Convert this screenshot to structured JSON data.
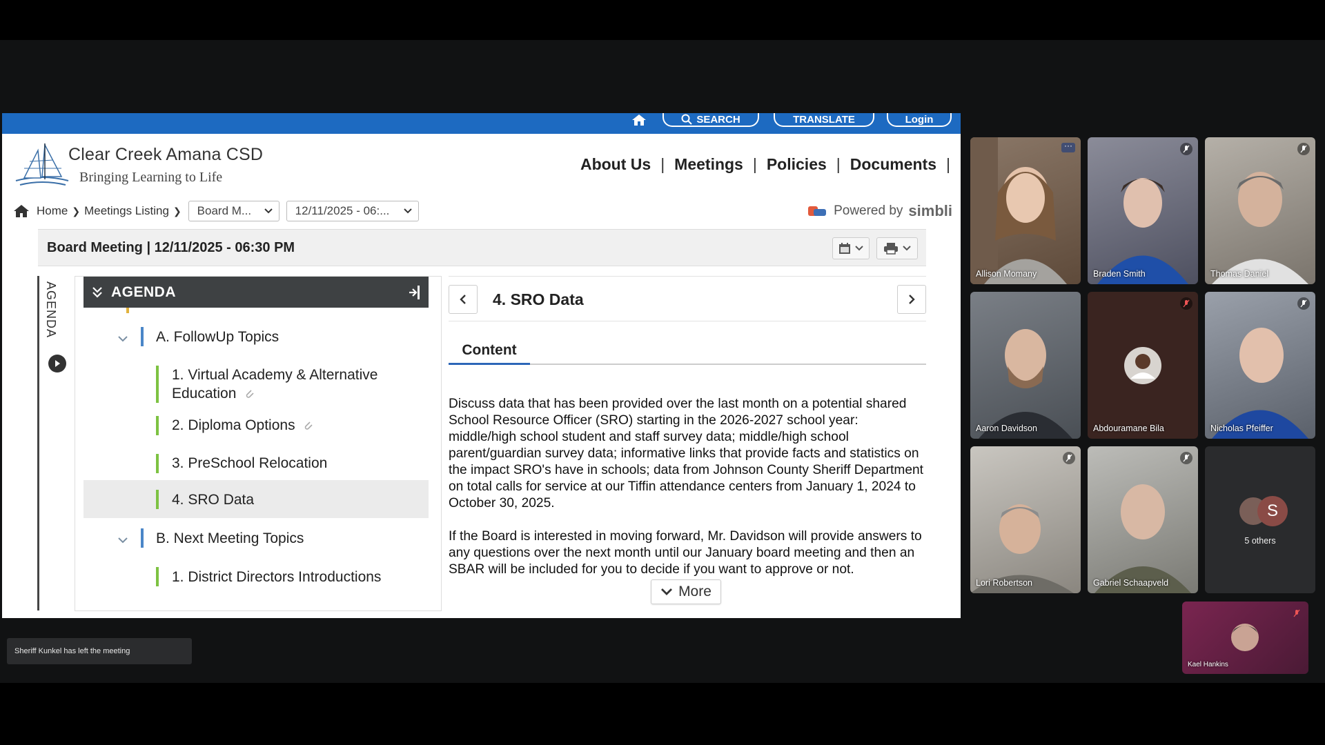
{
  "site": {
    "name": "Clear Creek Amana CSD",
    "tagline": "Bringing Learning to Life",
    "util": {
      "search": "SEARCH",
      "translate": "TRANSLATE",
      "login": "Login"
    },
    "nav": [
      "About Us",
      "Meetings",
      "Policies",
      "Documents"
    ],
    "breadcrumb": {
      "home": "Home",
      "listing": "Meetings Listing",
      "board_select": "Board M...",
      "date_select": "12/11/2025 - 06:..."
    },
    "powered_by": {
      "label": "Powered by",
      "brand": "simbli"
    }
  },
  "meeting": {
    "title": "Board Meeting | 12/11/2025 - 06:30 PM",
    "agenda_rail_label": "AGENDA",
    "agenda_header": "AGENDA",
    "agenda_items": [
      {
        "label": "A. FollowUp Topics",
        "level": "section"
      },
      {
        "label_line1": "1. Virtual Academy & Alternative",
        "label_line2": "Education",
        "level": "item",
        "attachment": true
      },
      {
        "label": "2. Diploma Options",
        "level": "item",
        "attachment": true
      },
      {
        "label": "3. PreSchool Relocation",
        "level": "item"
      },
      {
        "label": "4. SRO Data",
        "level": "item",
        "active": true
      },
      {
        "label": "B. Next Meeting Topics",
        "level": "section"
      },
      {
        "label": "1. District Directors Introductions",
        "level": "item"
      }
    ],
    "current_item": {
      "title": "4. SRO Data",
      "tab": "Content",
      "paragraph1": "Discuss data that has been provided over the last month on a potential shared School Resource Officer (SRO) starting in the 2026-2027 school year: middle/high school student and staff survey data; middle/high school parent/guardian survey data; informative links that provide facts and statistics on the impact SRO's have in schools; data from Johnson County Sheriff Department on total calls for service at our Tiffin attendance centers from January 1, 2024 to October 30, 2025.",
      "paragraph2": "If the Board is interested in moving forward, Mr. Davidson will provide answers to any questions over the next month until our January board meeting and then an SBAR will be included for you to decide if you want to approve or not.",
      "more": "More"
    }
  },
  "participants": [
    {
      "name": "Allison Momany"
    },
    {
      "name": "Braden Smith"
    },
    {
      "name": "Thomas Daniel"
    },
    {
      "name": "Aaron Davidson"
    },
    {
      "name": "Abdouramane Bila"
    },
    {
      "name": "Nicholas Pfeiffer"
    },
    {
      "name": "Lori Robertson"
    },
    {
      "name": "Gabriel Schaapveld"
    },
    {
      "name": "5 others",
      "avatar_letter": "S"
    },
    {
      "name": "Kael Hankins"
    }
  ],
  "notification": "Sheriff Kunkel has left the meeting",
  "colors": {
    "site_blue": "#1d6ac1",
    "agenda_green": "#7dc242",
    "section_blue": "#4a86c8",
    "header_dark": "#3e4143"
  }
}
